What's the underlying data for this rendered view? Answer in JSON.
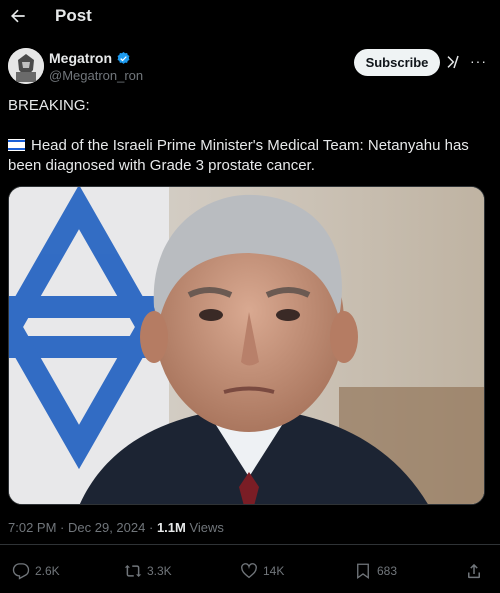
{
  "header": {
    "title": "Post"
  },
  "author": {
    "display_name": "Megatron",
    "handle": "@Megatron_ron"
  },
  "controls": {
    "subscribe_label": "Subscribe",
    "more_label": "···"
  },
  "post": {
    "line1": "BREAKING:",
    "line2": "Head of the Israeli Prime Minister's Medical Team: Netanyahu has been diagnosed with Grade 3 prostate cancer."
  },
  "meta": {
    "time": "7:02 PM",
    "separator": "·",
    "date": "Dec 29, 2024",
    "views_count": "1.1M",
    "views_label": "Views"
  },
  "actions": {
    "replies": "2.6K",
    "reposts": "3.3K",
    "likes": "14K",
    "bookmarks": "683"
  },
  "colors": {
    "background": "#000000",
    "muted": "#71767b",
    "verified": "#1d9bf0"
  },
  "icons": [
    "back-arrow-icon",
    "verified-badge-icon",
    "grok-icon",
    "more-icon",
    "reply-icon",
    "repost-icon",
    "like-icon",
    "bookmark-icon",
    "share-icon"
  ]
}
